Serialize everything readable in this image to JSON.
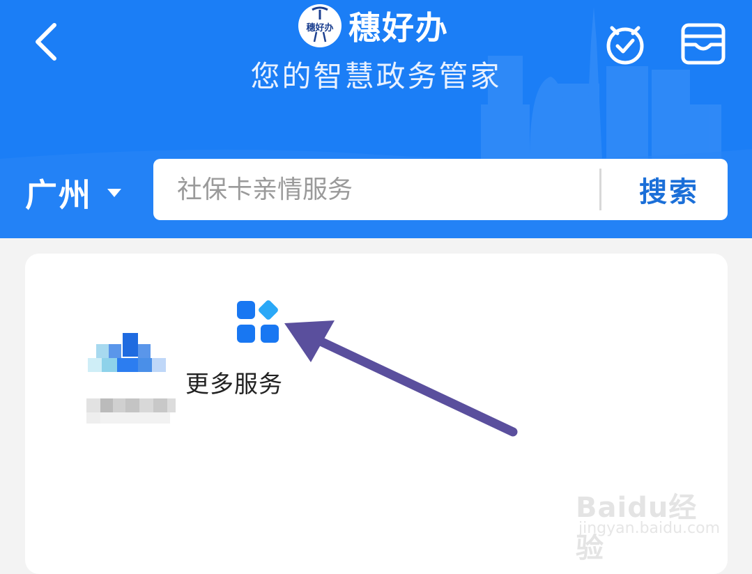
{
  "header": {
    "app_name": "穗好办",
    "logo_text": "穗好办",
    "subtitle": "您的智慧政务管家",
    "accent_color": "#1b7ef6",
    "back_icon": "chevron-left-icon",
    "timer_icon": "timer-check-icon",
    "wallet_icon": "wallet-icon"
  },
  "location": {
    "city": "广州"
  },
  "search": {
    "placeholder": "社保卡亲情服务",
    "value": "",
    "button_label": "搜索"
  },
  "services": {
    "items": [
      {
        "label": "",
        "icon": "blurred-service-icon",
        "blurred": true
      },
      {
        "label": "更多服务",
        "icon": "grid-apps-icon"
      }
    ]
  },
  "annotation": {
    "arrow_color": "#5a4f9d"
  },
  "watermark": {
    "main": "Baidu经验",
    "sub": "jingyan.baidu.com"
  }
}
